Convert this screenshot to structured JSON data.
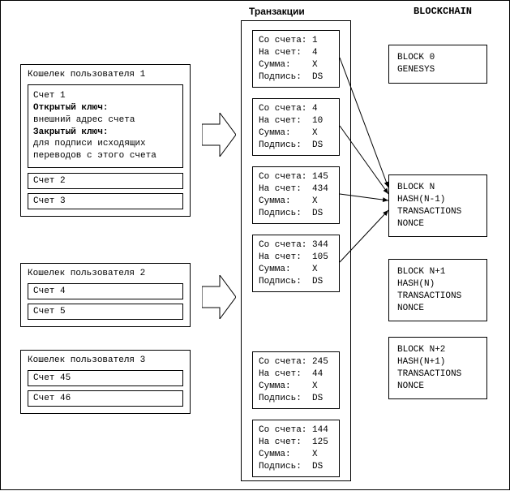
{
  "headers": {
    "transactions": "Транзакции",
    "blockchain": "BLOCKCHAIN"
  },
  "wallets": [
    {
      "title": "Кошелек пользователя 1",
      "detail": {
        "acc_label": "Счет 1",
        "open_key_label": "Открытый ключ:",
        "open_key_desc": "внешний адрес счета",
        "closed_key_label": "Закрытый ключ:",
        "closed_key_desc": "для подписи исходящих переводов с этого счета"
      },
      "accounts": [
        "Счет 2",
        "Счет 3"
      ]
    },
    {
      "title": "Кошелек пользователя 2",
      "accounts": [
        "Счет 4",
        "Счет 5"
      ]
    },
    {
      "title": "Кошелек пользователя 3",
      "accounts": [
        "Счет 45",
        "Счет 46"
      ]
    }
  ],
  "tx_labels": {
    "from": "Со счета:",
    "to": "На счет:",
    "sum": "Сумма:",
    "sig": "Подпись:"
  },
  "transactions": [
    {
      "from": "1",
      "to": "4",
      "sum": "X",
      "sig": "DS"
    },
    {
      "from": "4",
      "to": "10",
      "sum": "X",
      "sig": "DS"
    },
    {
      "from": "145",
      "to": "434",
      "sum": "X",
      "sig": "DS"
    },
    {
      "from": "344",
      "to": "105",
      "sum": "X",
      "sig": "DS"
    },
    {
      "from": "245",
      "to": "44",
      "sum": "X",
      "sig": "DS"
    },
    {
      "from": "144",
      "to": "125",
      "sum": "X",
      "sig": "DS"
    }
  ],
  "blocks": [
    {
      "lines": [
        "BLOCK 0",
        "GENESYS"
      ]
    },
    {
      "lines": [
        "BLOCK N",
        "HASH(N-1)",
        "TRANSACTIONS",
        "NONCE"
      ]
    },
    {
      "lines": [
        "BLOCK N+1",
        "HASH(N)",
        "TRANSACTIONS",
        "NONCE"
      ]
    },
    {
      "lines": [
        "BLOCK N+2",
        "HASH(N+1)",
        "TRANSACTIONS",
        "NONCE"
      ]
    }
  ],
  "chart_data": {
    "type": "table",
    "description": "Blockchain architecture diagram showing user wallets feeding transactions into a transaction pool, which are then grouped into blocks of a blockchain.",
    "wallets": [
      {
        "user": 1,
        "accounts": [
          1,
          2,
          3
        ]
      },
      {
        "user": 2,
        "accounts": [
          4,
          5
        ]
      },
      {
        "user": 3,
        "accounts": [
          45,
          46
        ]
      }
    ],
    "transactions": [
      {
        "from": 1,
        "to": 4,
        "amount": "X",
        "signature": "DS"
      },
      {
        "from": 4,
        "to": 10,
        "amount": "X",
        "signature": "DS"
      },
      {
        "from": 145,
        "to": 434,
        "amount": "X",
        "signature": "DS"
      },
      {
        "from": 344,
        "to": 105,
        "amount": "X",
        "signature": "DS"
      },
      {
        "from": 245,
        "to": 44,
        "amount": "X",
        "signature": "DS"
      },
      {
        "from": 144,
        "to": 125,
        "amount": "X",
        "signature": "DS"
      }
    ],
    "blockchain": [
      {
        "index": 0,
        "label": "GENESYS"
      },
      {
        "index": "N",
        "prev_hash": "HASH(N-1)",
        "contains": "TRANSACTIONS",
        "nonce": true
      },
      {
        "index": "N+1",
        "prev_hash": "HASH(N)",
        "contains": "TRANSACTIONS",
        "nonce": true
      },
      {
        "index": "N+2",
        "prev_hash": "HASH(N+1)",
        "contains": "TRANSACTIONS",
        "nonce": true
      }
    ],
    "arrows": [
      {
        "from": "wallet-1",
        "to": "tx-column"
      },
      {
        "from": "wallet-2",
        "to": "tx-column"
      },
      {
        "from": "tx-0",
        "to": "block-N"
      },
      {
        "from": "tx-1",
        "to": "block-N"
      },
      {
        "from": "tx-2",
        "to": "block-N"
      },
      {
        "from": "tx-3",
        "to": "block-N"
      }
    ]
  }
}
